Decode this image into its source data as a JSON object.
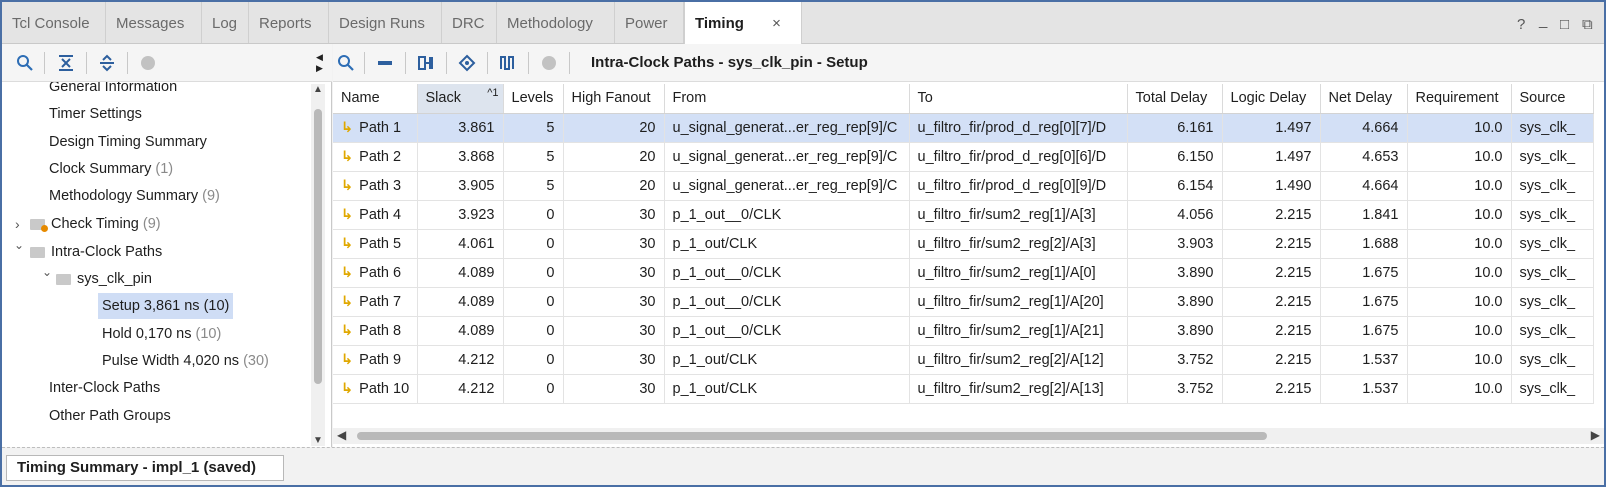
{
  "tabs": [
    "Tcl Console",
    "Messages",
    "Log",
    "Reports",
    "Design Runs",
    "DRC",
    "Methodology",
    "Power",
    "Timing"
  ],
  "active_tab_close": "×",
  "window_controls": [
    "?",
    "_",
    "□",
    "⧉"
  ],
  "tree": {
    "items": [
      {
        "label": "General Information",
        "count": ""
      },
      {
        "label": "Timer Settings",
        "count": ""
      },
      {
        "label": "Design Timing Summary",
        "count": ""
      },
      {
        "label": "Clock Summary",
        "count": "(1)"
      },
      {
        "label": "Methodology Summary",
        "count": "(9)"
      },
      {
        "label": "Check Timing",
        "count": "(9)"
      },
      {
        "label": "Intra-Clock Paths",
        "count": ""
      },
      {
        "label": "sys_clk_pin",
        "count": ""
      },
      {
        "label": "Setup 3,861 ns",
        "count": "(10)"
      },
      {
        "label": "Hold 0,170 ns",
        "count": "(10)"
      },
      {
        "label": "Pulse Width 4,020 ns",
        "count": "(30)"
      },
      {
        "label": "Inter-Clock Paths",
        "count": ""
      },
      {
        "label": "Other Path Groups",
        "count": ""
      }
    ],
    "expander_collapsed": "›",
    "expander_expanded": "⌄"
  },
  "panel_title": "Intra-Clock Paths - sys_clk_pin - Setup",
  "table": {
    "columns": [
      "Name",
      "Slack",
      "Levels",
      "High Fanout",
      "From",
      "To",
      "Total Delay",
      "Logic Delay",
      "Net Delay",
      "Requirement",
      "Source"
    ],
    "sort_indicator": "^1",
    "rows": [
      [
        "Path 1",
        "3.861",
        "5",
        "20",
        "u_signal_generat...er_reg_rep[9]/C",
        "u_filtro_fir/prod_d_reg[0][7]/D",
        "6.161",
        "1.497",
        "4.664",
        "10.0",
        "sys_clk_"
      ],
      [
        "Path 2",
        "3.868",
        "5",
        "20",
        "u_signal_generat...er_reg_rep[9]/C",
        "u_filtro_fir/prod_d_reg[0][6]/D",
        "6.150",
        "1.497",
        "4.653",
        "10.0",
        "sys_clk_"
      ],
      [
        "Path 3",
        "3.905",
        "5",
        "20",
        "u_signal_generat...er_reg_rep[9]/C",
        "u_filtro_fir/prod_d_reg[0][9]/D",
        "6.154",
        "1.490",
        "4.664",
        "10.0",
        "sys_clk_"
      ],
      [
        "Path 4",
        "3.923",
        "0",
        "30",
        "p_1_out__0/CLK",
        "u_filtro_fir/sum2_reg[1]/A[3]",
        "4.056",
        "2.215",
        "1.841",
        "10.0",
        "sys_clk_"
      ],
      [
        "Path 5",
        "4.061",
        "0",
        "30",
        "p_1_out/CLK",
        "u_filtro_fir/sum2_reg[2]/A[3]",
        "3.903",
        "2.215",
        "1.688",
        "10.0",
        "sys_clk_"
      ],
      [
        "Path 6",
        "4.089",
        "0",
        "30",
        "p_1_out__0/CLK",
        "u_filtro_fir/sum2_reg[1]/A[0]",
        "3.890",
        "2.215",
        "1.675",
        "10.0",
        "sys_clk_"
      ],
      [
        "Path 7",
        "4.089",
        "0",
        "30",
        "p_1_out__0/CLK",
        "u_filtro_fir/sum2_reg[1]/A[20]",
        "3.890",
        "2.215",
        "1.675",
        "10.0",
        "sys_clk_"
      ],
      [
        "Path 8",
        "4.089",
        "0",
        "30",
        "p_1_out__0/CLK",
        "u_filtro_fir/sum2_reg[1]/A[21]",
        "3.890",
        "2.215",
        "1.675",
        "10.0",
        "sys_clk_"
      ],
      [
        "Path 9",
        "4.212",
        "0",
        "30",
        "p_1_out/CLK",
        "u_filtro_fir/sum2_reg[2]/A[12]",
        "3.752",
        "2.215",
        "1.537",
        "10.0",
        "sys_clk_"
      ],
      [
        "Path 10",
        "4.212",
        "0",
        "30",
        "p_1_out/CLK",
        "u_filtro_fir/sum2_reg[2]/A[13]",
        "3.752",
        "2.215",
        "1.537",
        "10.0",
        "sys_clk_"
      ]
    ]
  },
  "bottom_tab": "Timing Summary - impl_1 (saved)",
  "colors": {
    "accent": "#4a6fa5",
    "selection": "#d3e0f6",
    "path_arrow": "#e0a800"
  }
}
